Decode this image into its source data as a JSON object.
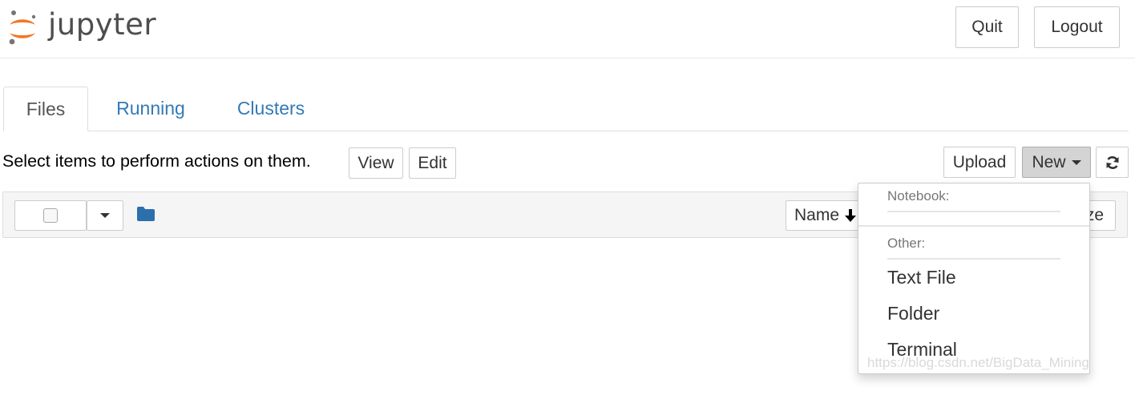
{
  "header": {
    "logo_text": "jupyter",
    "quit_label": "Quit",
    "logout_label": "Logout"
  },
  "tabs": [
    {
      "label": "Files",
      "active": true
    },
    {
      "label": "Running",
      "active": false
    },
    {
      "label": "Clusters",
      "active": false
    }
  ],
  "toolbar": {
    "hint": "Select items to perform actions on them.",
    "view_label": "View",
    "edit_label": "Edit",
    "upload_label": "Upload",
    "new_label": "New"
  },
  "list_header": {
    "name_label": "Name",
    "size_label_partial": "ze"
  },
  "new_menu": {
    "notebook_header": "Notebook:",
    "other_header": "Other:",
    "items": [
      "Text File",
      "Folder",
      "Terminal"
    ]
  },
  "watermark": "https://blog.csdn.net/BigData_Mining",
  "colors": {
    "link": "#337ab7",
    "folder": "#2c6fad",
    "logo_orange": "#f37726",
    "logo_gray": "#767677"
  }
}
